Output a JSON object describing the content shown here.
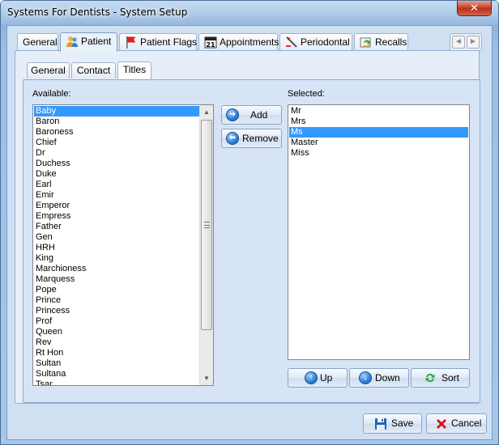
{
  "window": {
    "title": "Systems For Dentists - System Setup",
    "close_glyph": "✕"
  },
  "top_tabs": [
    {
      "label": "General",
      "icon": "none"
    },
    {
      "label": "Patient",
      "icon": "people-icon"
    },
    {
      "label": "Patient Flags",
      "icon": "flag-icon"
    },
    {
      "label": "Appointments",
      "icon": "calendar-icon"
    },
    {
      "label": "Periodontal",
      "icon": "probe-icon"
    },
    {
      "label": "Recalls",
      "icon": "recall-icon"
    }
  ],
  "calendar_day": "21",
  "nav": {
    "prev": "◄",
    "next": "►"
  },
  "sub_tabs": [
    {
      "label": "General"
    },
    {
      "label": "Contact"
    },
    {
      "label": "Titles"
    }
  ],
  "available": {
    "label": "Available:",
    "items": [
      "Baby",
      "Baron",
      "Baroness",
      "Chief",
      "Dr",
      "Duchess",
      "Duke",
      "Earl",
      "Emir",
      "Emperor",
      "Empress",
      "Father",
      "Gen",
      "HRH",
      "King",
      "Marchioness",
      "Marquess",
      "Pope",
      "Prince",
      "Princess",
      "Prof",
      "Queen",
      "Rev",
      "Rt Hon",
      "Sultan",
      "Sultana",
      "Tsar"
    ],
    "selected_index": 0
  },
  "selected": {
    "label": "Selected:",
    "items": [
      "Mr",
      "Mrs",
      "Ms",
      "Master",
      "Miss"
    ],
    "selected_index": 2
  },
  "buttons": {
    "add": "Add",
    "remove": "Remove",
    "up": "Up",
    "down": "Down",
    "sort": "Sort",
    "save": "Save",
    "cancel": "Cancel"
  },
  "colors": {
    "selection": "#3399ff",
    "cancel_red": "#d3141c"
  }
}
